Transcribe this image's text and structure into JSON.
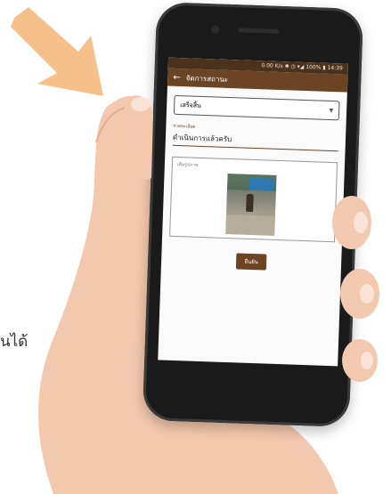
{
  "side_caption": "นได้",
  "status_bar": {
    "text": "0.00 K/s ✱ ◷ ▾◢ 100% ▮ 14:39"
  },
  "app_bar": {
    "title": "จัดการสถานะ"
  },
  "status_select": {
    "value": "เสร็จสิ้น"
  },
  "detail_field": {
    "label": "รายละเอียด",
    "value": "ดำเนินการแล้วครับ"
  },
  "photo_section": {
    "label": "เพิ่มรูปภาพ"
  },
  "confirm_button": {
    "label": "ยืนยัน"
  },
  "colors": {
    "arrow": "#f5c08a",
    "app_bar": "#6b4423",
    "status_bar": "#4a321c",
    "skin": "#f2c9ae"
  }
}
